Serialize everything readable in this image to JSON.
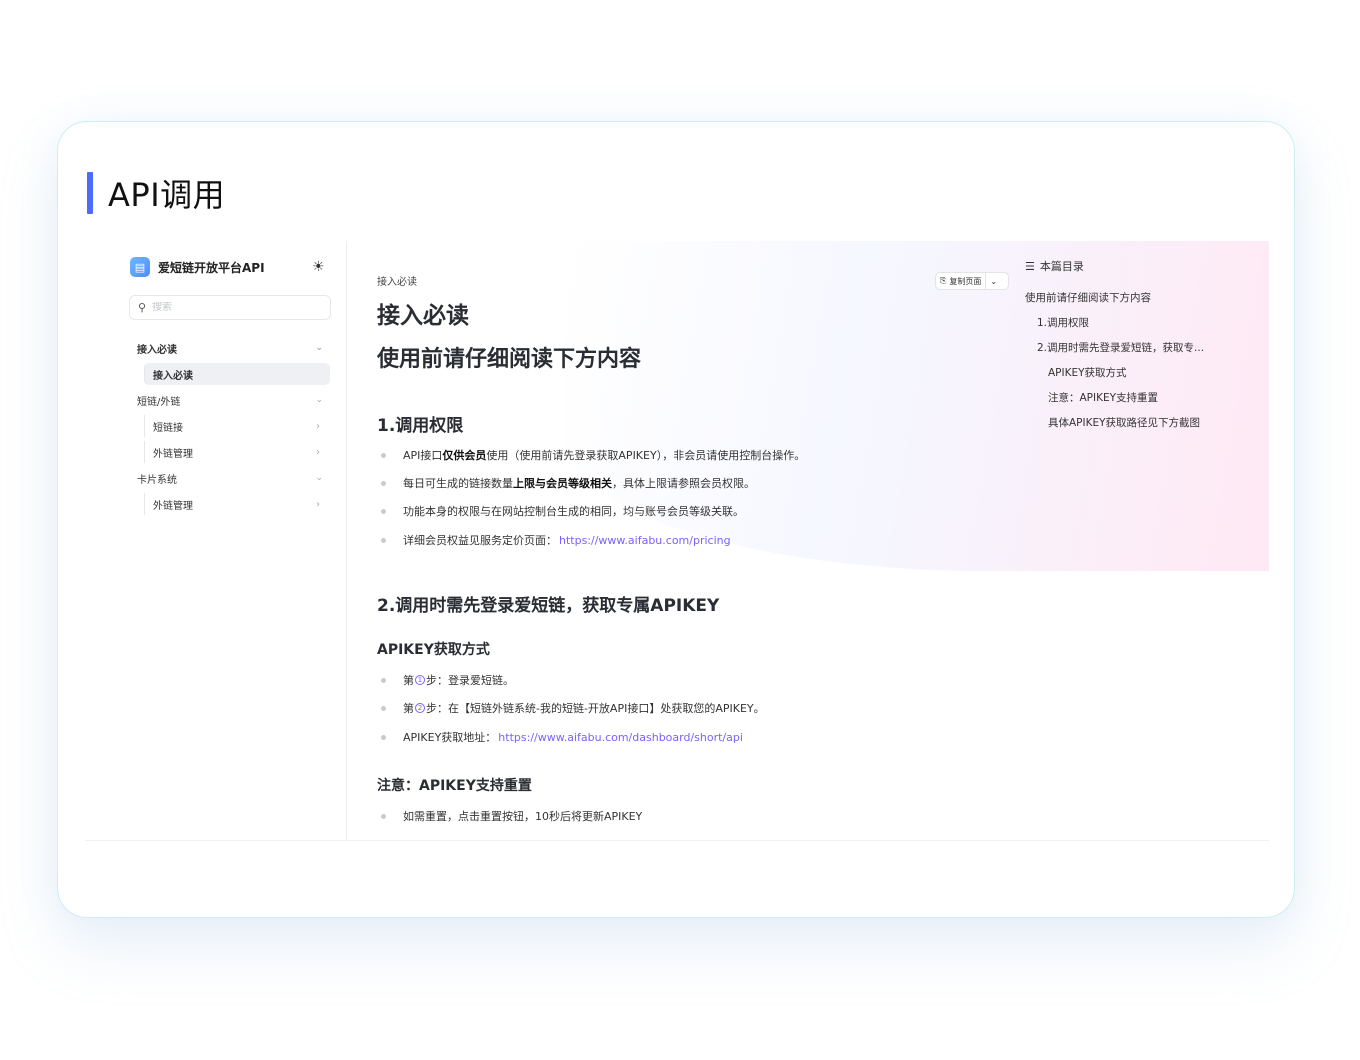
{
  "card": {
    "title": "API调用"
  },
  "sidebar": {
    "brand": "爱短链开放平台API",
    "search_placeholder": "搜索",
    "groups": [
      {
        "label": "接入必读",
        "items": [
          {
            "label": "接入必读",
            "active": true
          }
        ]
      },
      {
        "label": "短链/外链",
        "items": [
          {
            "label": "短链接"
          },
          {
            "label": "外链管理"
          }
        ]
      },
      {
        "label": "卡片系统",
        "items": [
          {
            "label": "外链管理"
          }
        ]
      }
    ]
  },
  "main": {
    "breadcrumb": "接入必读",
    "title": "接入必读",
    "subtitle": "使用前请仔细阅读下方内容",
    "copy_button": "复制页面",
    "section1": {
      "heading": "1.调用权限",
      "items": [
        {
          "pre": "API接口",
          "bold": "仅供会员",
          "post": "使用（使用前请先登录获取APIKEY），非会员请使用控制台操作。"
        },
        {
          "pre": "每日可生成的链接数量",
          "bold": "上限与会员等级相关",
          "post": "，具体上限请参照会员权限。"
        },
        {
          "text": "功能本身的权限与在网站控制台生成的相同，均与账号会员等级关联。"
        },
        {
          "pre": "详细会员权益见服务定价页面：",
          "link": "https://www.aifabu.com/pricing"
        }
      ]
    },
    "section2": {
      "heading": "2.调用时需先登录爱短链，获取专属APIKEY",
      "sub1": "APIKEY获取方式",
      "steps": [
        {
          "pre": "第",
          "num": "1",
          "post": "步：登录爱短链。"
        },
        {
          "pre": "第",
          "num": "2",
          "post": "步：在【短链外链系统-我的短链-开放API接口】处获取您的APIKEY。"
        }
      ],
      "addr_label": "APIKEY获取地址：",
      "addr_link": "https://www.aifabu.com/dashboard/short/api",
      "sub2": "注意：APIKEY支持重置",
      "note": "如需重置，点击重置按钮，10秒后将更新APIKEY"
    }
  },
  "toc": {
    "title": "本篇目录",
    "items": [
      {
        "label": "使用前请仔细阅读下方内容",
        "level": 0
      },
      {
        "label": "1.调用权限",
        "level": 1
      },
      {
        "label": "2.调用时需先登录爱短链，获取专...",
        "level": 1
      },
      {
        "label": "APIKEY获取方式",
        "level": 2
      },
      {
        "label": "注意：APIKEY支持重置",
        "level": 2
      },
      {
        "label": "具体APIKEY获取路径见下方截图",
        "level": 2
      }
    ]
  },
  "colors": {
    "accent_bar": "#4d6bfe",
    "link": "#7b61ff",
    "card_border": "#cdeef3"
  },
  "icons": {
    "theme": "sun-icon",
    "search": "search-icon",
    "toc": "list-icon",
    "copy": "clipboard-icon"
  }
}
